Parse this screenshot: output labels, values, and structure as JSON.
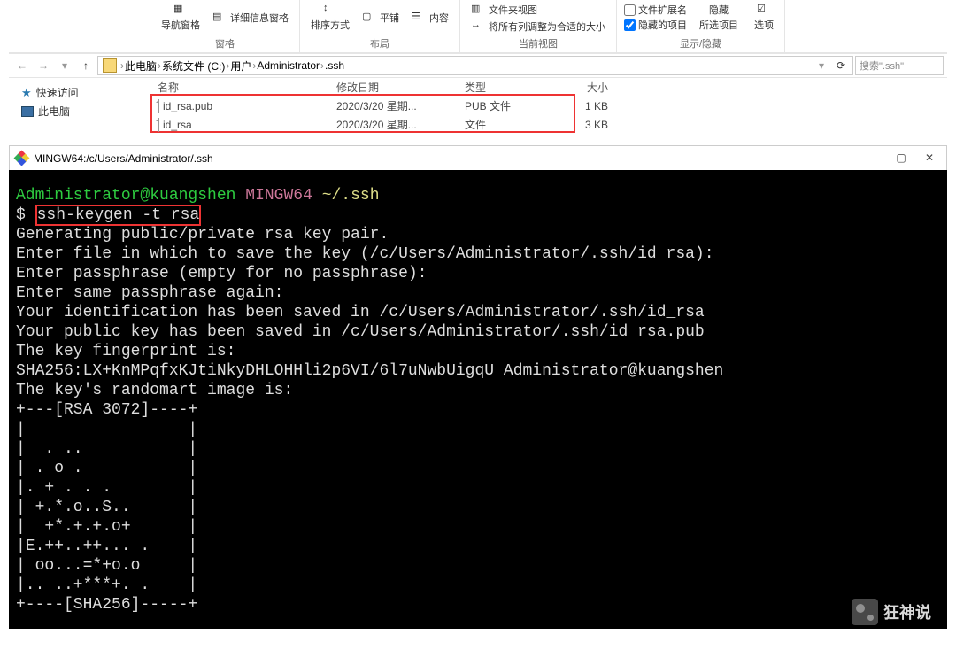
{
  "ribbon": {
    "nav_pane": "导航窗格",
    "detail_pane": "详细信息窗格",
    "group_pane": "窗格",
    "sort": "排序方式",
    "tile": "平铺",
    "content": "内容",
    "group_layout": "布局",
    "group_by": "文件夹视图",
    "fit_cols": "将所有列调整为合适的大小",
    "group_view": "当前视图",
    "file_ext": "文件扩展名",
    "hidden_items": "隐藏的项目",
    "hide": "隐藏",
    "hide_selected": "所选项目",
    "options": "选项",
    "group_show": "显示/隐藏"
  },
  "breadcrumbs": [
    "此电脑",
    "系统文件 (C:)",
    "用户",
    "Administrator",
    ".ssh"
  ],
  "search_placeholder": "搜索\".ssh\"",
  "sidebar": {
    "quick": "快速访问",
    "pc": "此电脑"
  },
  "columns": {
    "name": "名称",
    "date": "修改日期",
    "type": "类型",
    "size": "大小"
  },
  "files": [
    {
      "name": "id_rsa.pub",
      "date": "2020/3/20 星期...",
      "type": "PUB 文件",
      "size": "1 KB"
    },
    {
      "name": "id_rsa",
      "date": "2020/3/20 星期...",
      "type": "文件",
      "size": "3 KB"
    }
  ],
  "terminal_title": "MINGW64:/c/Users/Administrator/.ssh",
  "term": {
    "user": "Administrator@kuangshen",
    "env": "MINGW64",
    "path": "~/.ssh",
    "cmd": "ssh-keygen -t rsa",
    "lines": [
      "Generating public/private rsa key pair.",
      "Enter file in which to save the key (/c/Users/Administrator/.ssh/id_rsa):",
      "Enter passphrase (empty for no passphrase):",
      "Enter same passphrase again:",
      "Your identification has been saved in /c/Users/Administrator/.ssh/id_rsa",
      "Your public key has been saved in /c/Users/Administrator/.ssh/id_rsa.pub",
      "The key fingerprint is:",
      "SHA256:LX+KnMPqfxKJtiNkyDHLOHHli2p6VI/6l7uNwbUigqU Administrator@kuangshen",
      "The key's randomart image is:",
      "+---[RSA 3072]----+",
      "|                 |",
      "|  . ..           |",
      "| . o .           |",
      "|. + . . .        |",
      "| +.*.o..S..      |",
      "|  +*.+.+.o+      |",
      "|E.++..++... .    |",
      "| oo...=*+o.o     |",
      "|.. ..+***+. .    |",
      "+----[SHA256]-----+"
    ]
  },
  "watermark": "狂神说"
}
